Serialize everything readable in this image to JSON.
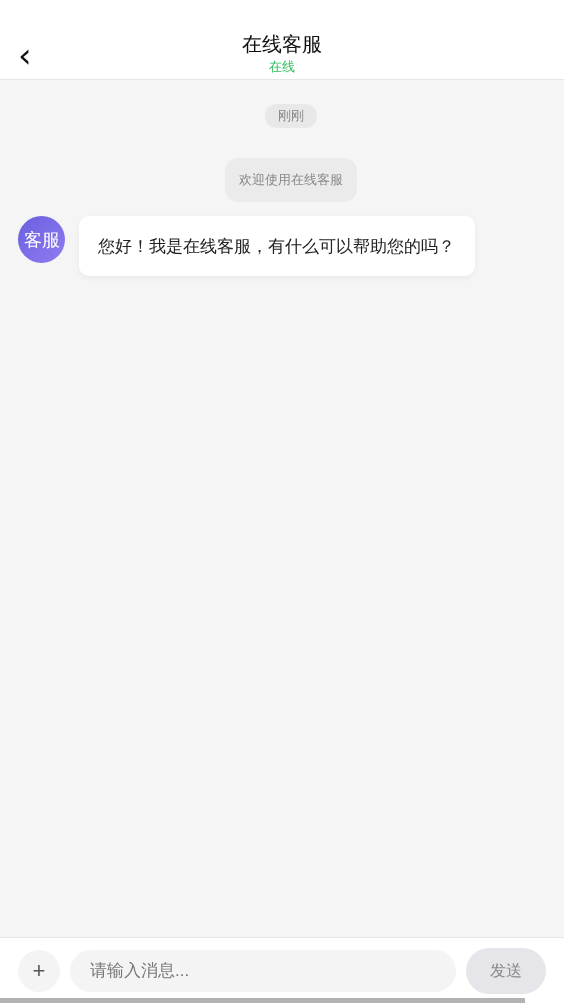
{
  "header": {
    "back": "‹",
    "title": "在线客服",
    "status": "在线",
    "online": true
  },
  "messages": [
    {
      "kind": "time",
      "text": "刚刚"
    },
    {
      "kind": "system",
      "text": "欢迎使用在线客服"
    },
    {
      "kind": "incoming",
      "avatar": "客服",
      "text": "您好！我是在线客服，有什么可以帮助您的吗？"
    }
  ],
  "composer": {
    "plus": "+",
    "placeholder": "请输入消息...",
    "send": "发送",
    "send_disabled": true
  }
}
